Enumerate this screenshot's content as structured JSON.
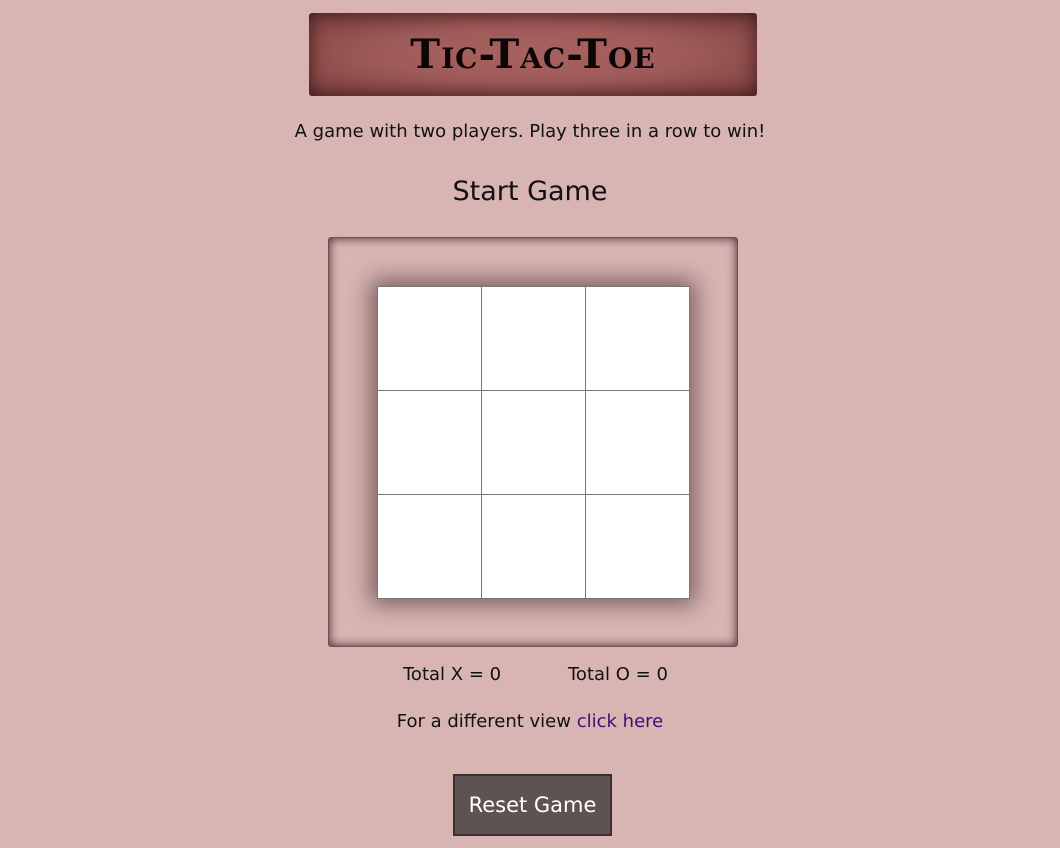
{
  "header": {
    "title": "Tic-Tac-Toe"
  },
  "intro": {
    "subtitle": "A game with two players. Play three in a row to win!",
    "start_label": "Start Game"
  },
  "board": {
    "cells": [
      "",
      "",
      "",
      "",
      "",
      "",
      "",
      "",
      ""
    ]
  },
  "scores": {
    "x_label": "Total X = 0",
    "o_label": "Total O = 0"
  },
  "view_switch": {
    "prefix": "For a different view",
    "link_text": "click here"
  },
  "controls": {
    "reset_label": "Reset Game"
  },
  "colors": {
    "background": "#d8b4b3",
    "banner": "#a05c5a",
    "button": "#5e5252",
    "link": "#3b0f7a"
  }
}
